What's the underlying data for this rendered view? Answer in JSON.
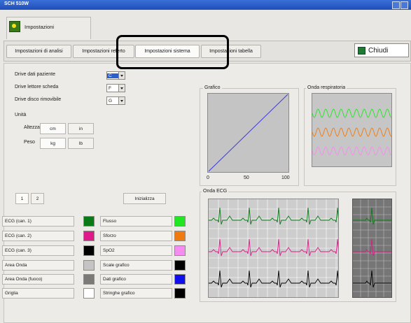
{
  "window": {
    "title": "SCH 510W"
  },
  "header": {
    "title": "Impostazioni"
  },
  "tabs": [
    {
      "label": "Impostazioni di analisi"
    },
    {
      "label": "Impostazioni referto"
    },
    {
      "label": "Impostazioni sistema"
    },
    {
      "label": "Impostazioni tabella"
    }
  ],
  "close_button": {
    "label": "Chiudi"
  },
  "drives": [
    {
      "label": "Drive dati paziente",
      "value": "C"
    },
    {
      "label": "Drive lettore scheda",
      "value": "F"
    },
    {
      "label": "Drive disco rimovibile",
      "value": "G"
    }
  ],
  "units": {
    "title": "Unità",
    "height": {
      "label": "Altezza",
      "options": [
        "cm",
        "in"
      ],
      "selected": "cm"
    },
    "weight": {
      "label": "Peso",
      "options": [
        "kg",
        "lb"
      ],
      "selected": "kg"
    }
  },
  "pages": [
    "1",
    "2"
  ],
  "reset_button": {
    "label": "Inizializza"
  },
  "left_colors": [
    {
      "label": "ECG (can. 1)",
      "color": "#0a7a16"
    },
    {
      "label": "ECG (can. 2)",
      "color": "#e0198a"
    },
    {
      "label": "ECG (can. 3)",
      "color": "#000000"
    },
    {
      "label": "Area Onda",
      "color": "#c4c4c4"
    },
    {
      "label": "Area Onda (fuoco)",
      "color": "#7a7a7a"
    },
    {
      "label": "Griglia",
      "color": "#ffffff"
    }
  ],
  "right_colors": [
    {
      "label": "Flusso",
      "color": "#22e622"
    },
    {
      "label": "Sforzo",
      "color": "#f07a10"
    },
    {
      "label": "SpO2",
      "color": "#f58cf0"
    },
    {
      "label": "Scale grafico",
      "color": "#000000"
    },
    {
      "label": "Dati grafico",
      "color": "#1010e8"
    },
    {
      "label": "Stringhe grafico",
      "color": "#000000"
    }
  ],
  "graph": {
    "title": "Grafico",
    "ticks": [
      "0",
      "50",
      "100"
    ]
  },
  "resp": {
    "title": "Onda respiratoria"
  },
  "ecg": {
    "title": "Onda ECG"
  }
}
